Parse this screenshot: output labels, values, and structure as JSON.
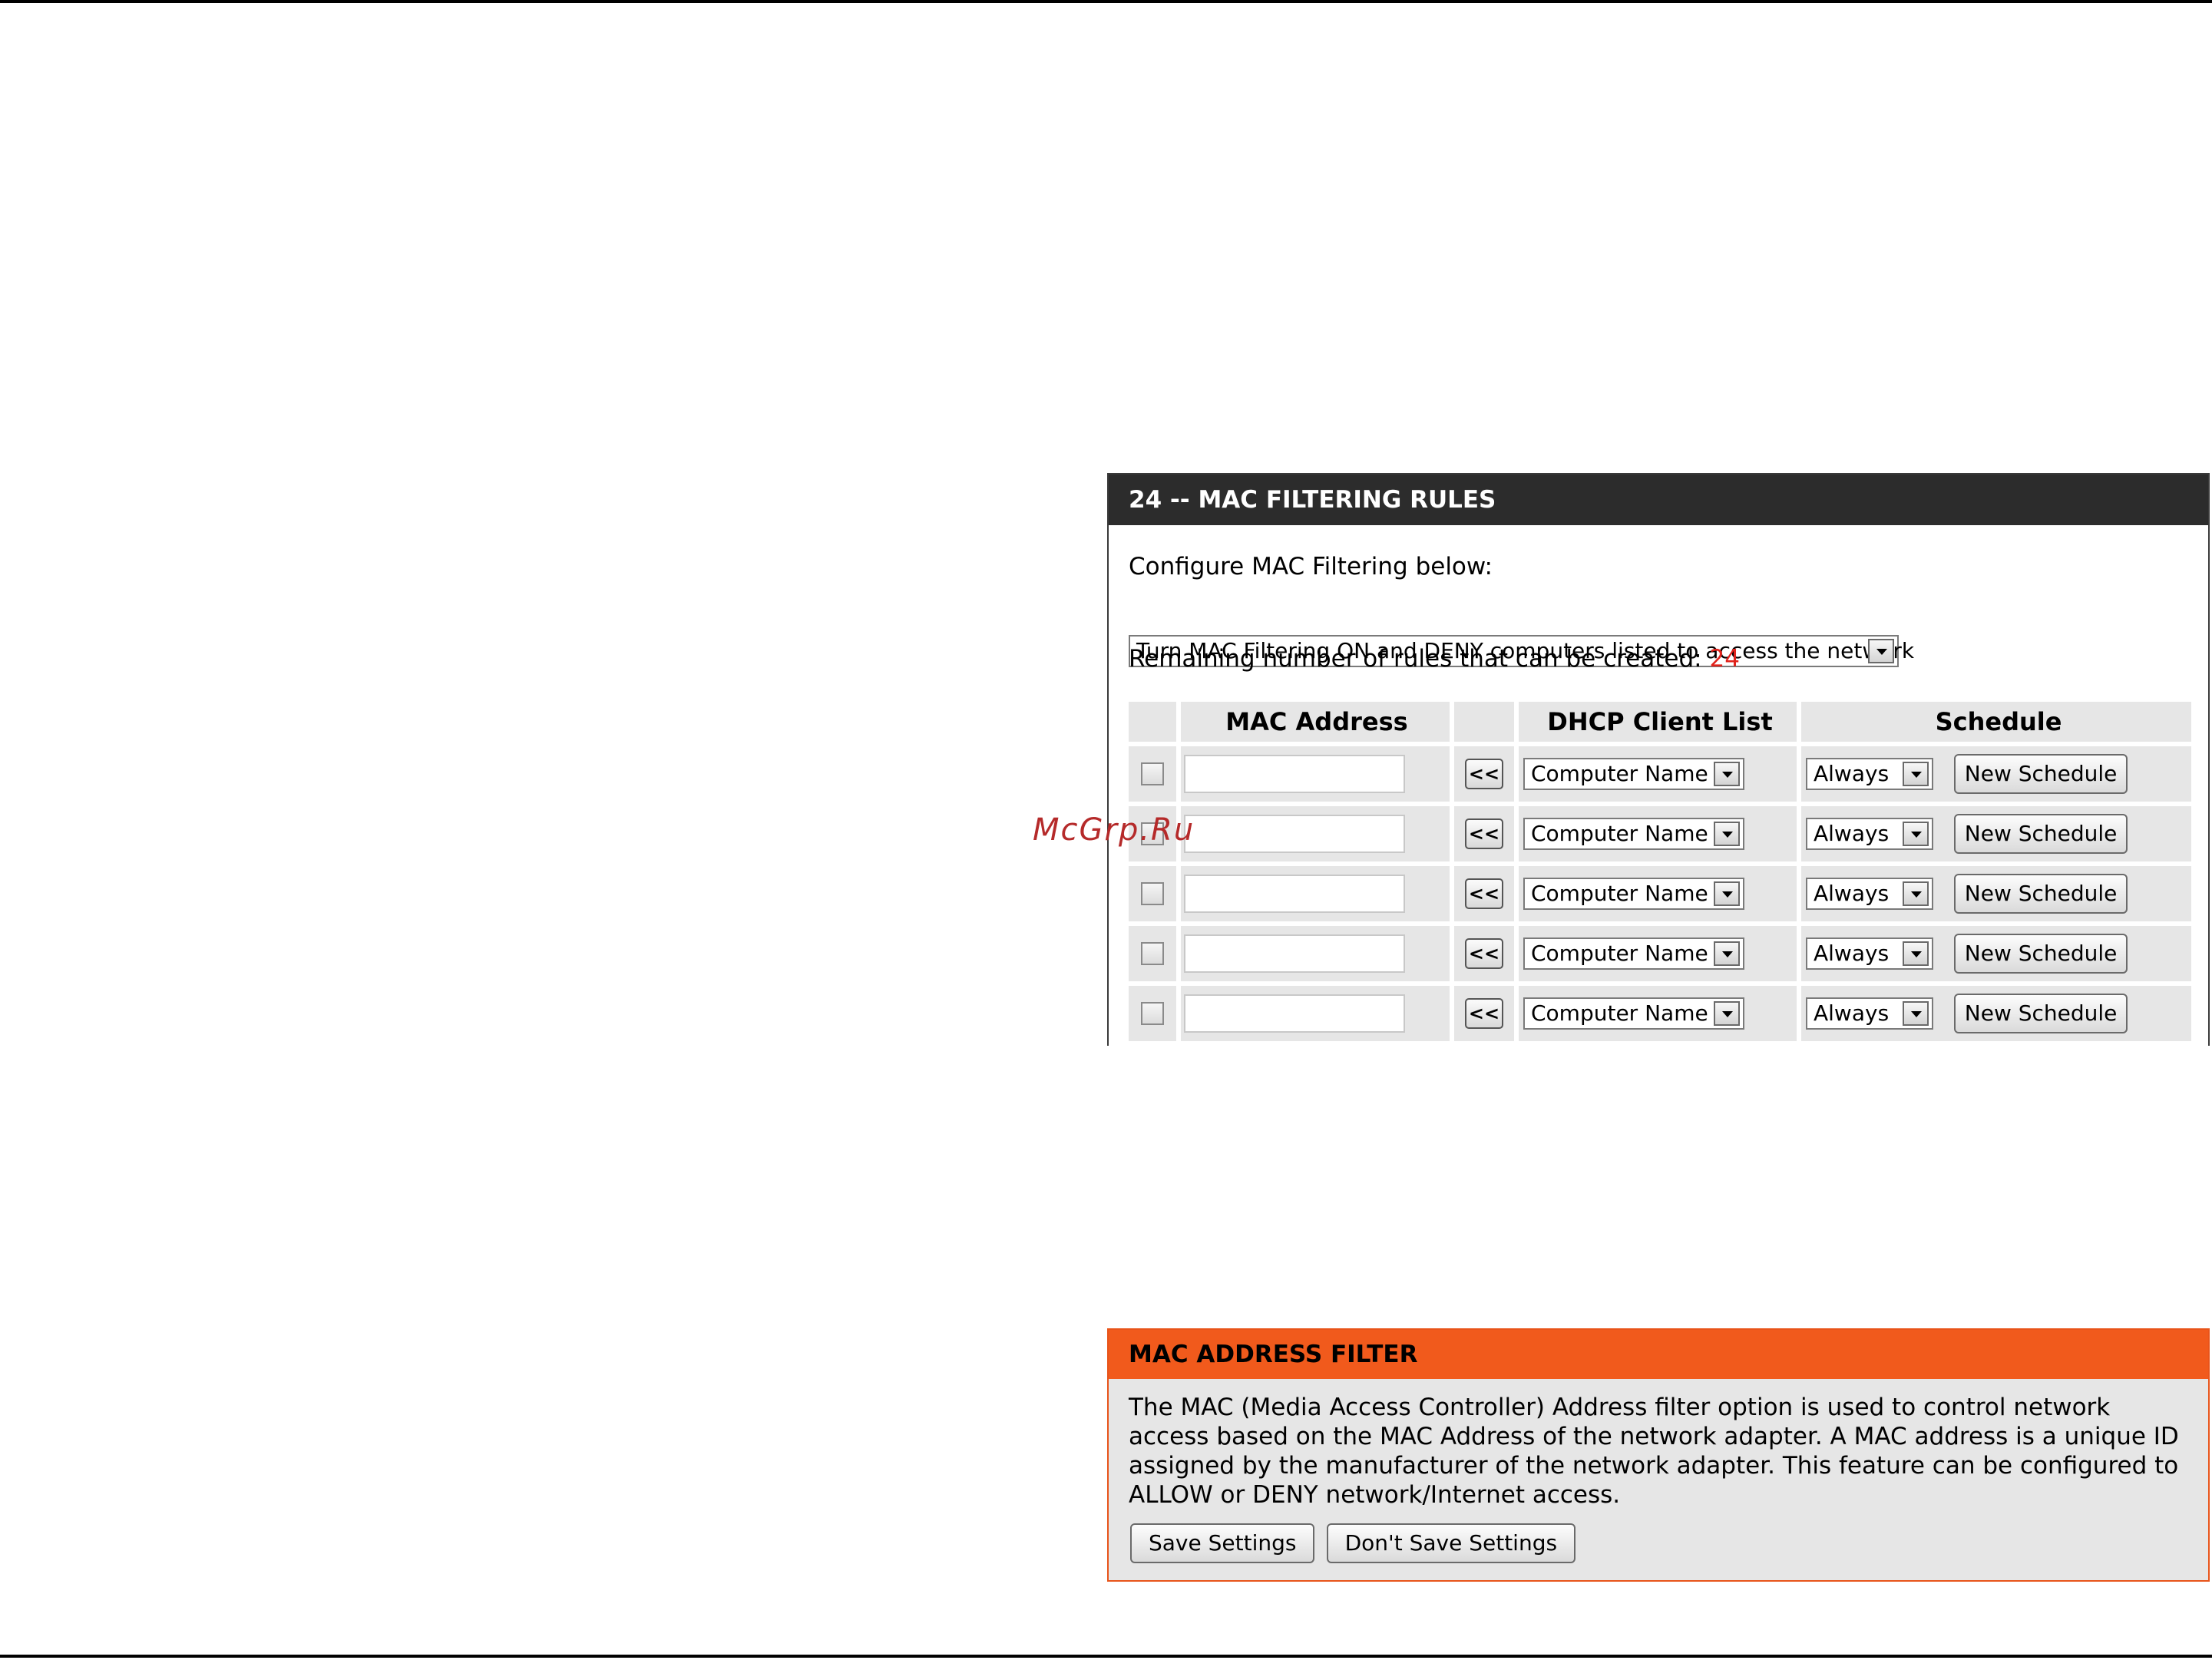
{
  "rules_panel": {
    "title": "24 -- MAC FILTERING RULES",
    "config_label": "Configure MAC Filtering below:",
    "mode_value": "Turn MAC Filtering ON and DENY computers listed to access the network",
    "remaining_label": "Remaining number of rules that can be created:",
    "remaining_count": "24",
    "headers": {
      "mac": "MAC Address",
      "dhcp": "DHCP Client List",
      "schedule": "Schedule"
    },
    "rows": [
      {
        "mac": "",
        "copy": "<<",
        "dhcp": "Computer Name",
        "schedule": "Always",
        "new_schedule": "New Schedule"
      },
      {
        "mac": "",
        "copy": "<<",
        "dhcp": "Computer Name",
        "schedule": "Always",
        "new_schedule": "New Schedule"
      },
      {
        "mac": "",
        "copy": "<<",
        "dhcp": "Computer Name",
        "schedule": "Always",
        "new_schedule": "New Schedule"
      },
      {
        "mac": "",
        "copy": "<<",
        "dhcp": "Computer Name",
        "schedule": "Always",
        "new_schedule": "New Schedule"
      },
      {
        "mac": "",
        "copy": "<<",
        "dhcp": "Computer Name",
        "schedule": "Always",
        "new_schedule": "New Schedule"
      }
    ]
  },
  "watermark": "McGrp.Ru",
  "filter_panel": {
    "title": "MAC ADDRESS FILTER",
    "description": "The MAC (Media Access Controller) Address filter option is used to control network access based on the MAC Address of the network adapter. A MAC address is a unique ID assigned by the manufacturer of the network adapter. This feature can be configured to ALLOW or DENY network/Internet access.",
    "save_label": "Save Settings",
    "dont_save_label": "Don't Save Settings"
  },
  "colors": {
    "header_dark": "#2c2c2c",
    "header_orange": "#f15a1c",
    "count_red": "#e0221b"
  },
  "icons": [
    "dropdown-arrow-icon",
    "checkbox-icon"
  ]
}
